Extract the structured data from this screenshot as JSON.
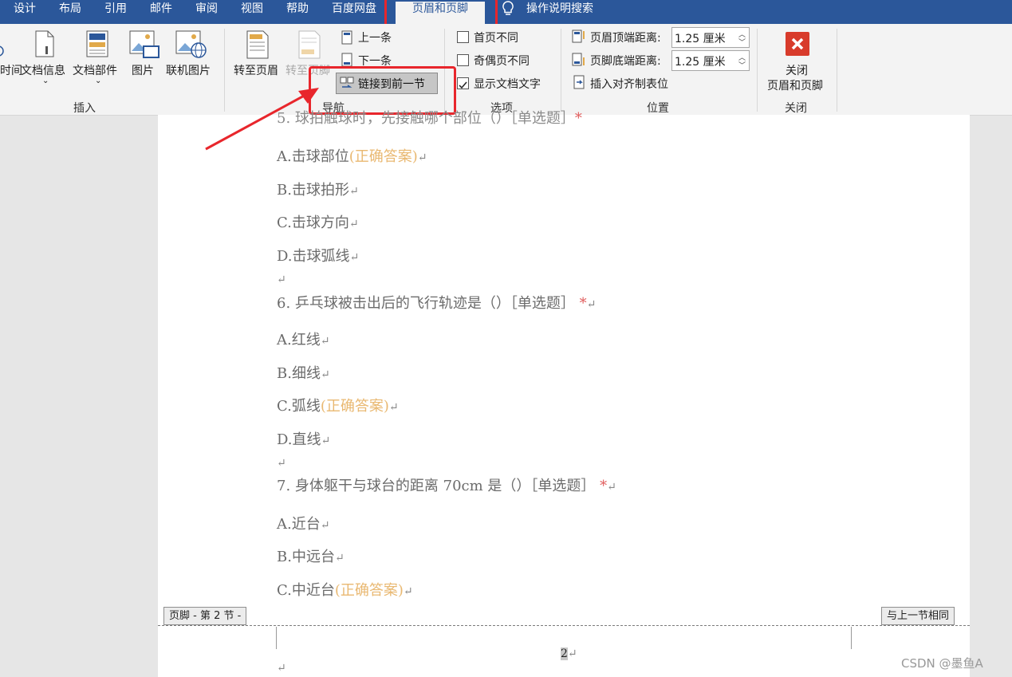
{
  "tabs": {
    "design": "设计",
    "layout": "布局",
    "references": "引用",
    "mailings": "邮件",
    "review": "审阅",
    "view": "视图",
    "help": "帮助",
    "baidu": "百度网盘",
    "header_footer": "页眉和页脚",
    "tell_me": "操作说明搜索"
  },
  "ribbon": {
    "insert": {
      "date_time": "时间",
      "doc_info": "文档信息",
      "quick_parts": "文档部件",
      "pictures": "图片",
      "online_pictures": "联机图片",
      "label": "插入"
    },
    "navigation": {
      "goto_header": "转至页眉",
      "goto_footer": "转至页脚",
      "previous": "上一条",
      "next": "下一条",
      "link_previous": "链接到前一节",
      "label": "导航"
    },
    "options": {
      "different_first": "首页不同",
      "different_odd_even": "奇偶页不同",
      "show_doc_text": "显示文档文字",
      "label": "选项",
      "different_first_checked": false,
      "different_odd_even_checked": false,
      "show_doc_text_checked": true
    },
    "position": {
      "header_top_label": "页眉顶端距离:",
      "header_top_value": "1.25 厘米",
      "footer_bottom_label": "页脚底端距离:",
      "footer_bottom_value": "1.25 厘米",
      "insert_align_tab": "插入对齐制表位",
      "label": "位置"
    },
    "close": {
      "line1": "关闭",
      "line2": "页眉和页脚",
      "label": "关闭"
    }
  },
  "document": {
    "q5_partial": "5. 球拍触球时，先接触哪个部位（）［单选题］",
    "q5_options": [
      "A.击球部位",
      "B.击球拍形",
      "C.击球方向",
      "D.击球弧线"
    ],
    "q6_title": "6. 乒乓球被击出后的飞行轨迹是（）［单选题］",
    "q6_options": [
      "A.红线",
      "B.细线",
      "C.弧线",
      "D.直线"
    ],
    "q7_title": "7. 身体躯干与球台的距离 70cm 是（）［单选题］",
    "q7_options": [
      "A.近台",
      "B.中远台",
      "C.中近台"
    ],
    "correct_mark": "(正确答案)",
    "required_star": "*",
    "return_mark": "↵",
    "footer_tag": "页脚 - 第 2 节 -",
    "same_as_previous": "与上一节相同",
    "page_number": "2"
  },
  "watermark": "CSDN @墨鱼A",
  "colors": {
    "tabbar": "#2b579a",
    "ribbon": "#f3f3f3",
    "answer": "#e9b871",
    "highlight_red": "#e8262c"
  }
}
